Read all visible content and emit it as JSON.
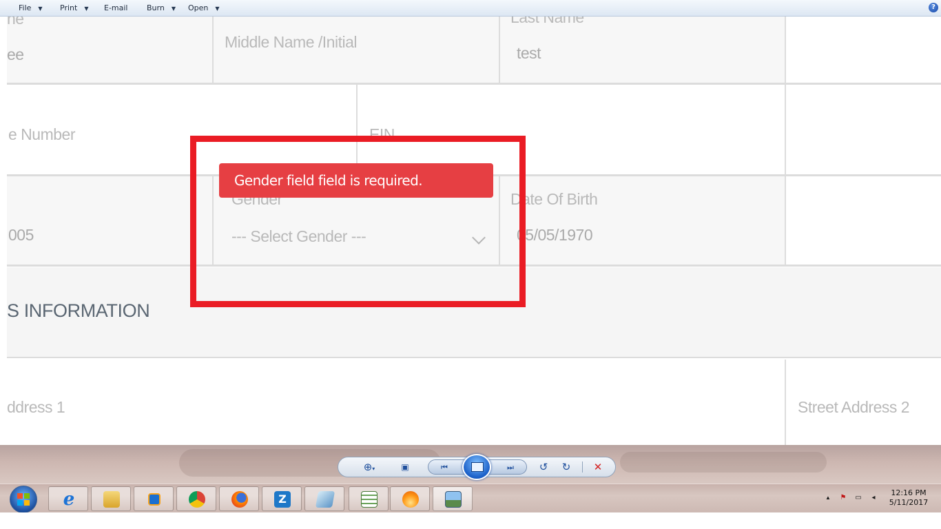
{
  "viewer": {
    "menu": {
      "file": "File",
      "print": "Print",
      "email": "E-mail",
      "burn": "Burn",
      "open": "Open",
      "help_icon": "?"
    },
    "controls": {
      "zoom": "zoom-icon",
      "fit": "actual-size-icon",
      "previous": "previous-icon",
      "slideshow": "slideshow-icon",
      "next": "next-icon",
      "rotate_ccw": "rotate-counterclockwise-icon",
      "rotate_cw": "rotate-clockwise-icon",
      "delete": "delete-icon"
    }
  },
  "form": {
    "row1": {
      "first_name_label": "ne",
      "first_name_value": "ee",
      "middle_name_label": "Middle Name /Initial",
      "last_name_label": "Last Name",
      "last_name_value": "test"
    },
    "row2": {
      "phone_label": "e Number",
      "ein_label": "EIN"
    },
    "row3": {
      "zip_value": "005",
      "gender_label": "Gender",
      "gender_placeholder": "--- Select Gender ---",
      "dob_label": "Date Of Birth",
      "dob_value": "05/05/1970"
    },
    "error_message": "Gender field field is required.",
    "section_title": "S INFORMATION",
    "row4": {
      "address1_label": "ddress 1",
      "address2_label": "Street Address 2"
    }
  },
  "taskbar": {
    "apps": [
      {
        "name": "internet-explorer-icon",
        "glyph": "e"
      },
      {
        "name": "file-explorer-icon",
        "glyph": ""
      },
      {
        "name": "media-player-icon",
        "glyph": ""
      },
      {
        "name": "chrome-icon",
        "glyph": ""
      },
      {
        "name": "firefox-icon",
        "glyph": ""
      },
      {
        "name": "zoho-icon",
        "glyph": "Z"
      },
      {
        "name": "notes-icon",
        "glyph": ""
      },
      {
        "name": "spreadsheet-icon",
        "glyph": ""
      },
      {
        "name": "flame-app-icon",
        "glyph": ""
      },
      {
        "name": "photo-viewer-icon",
        "glyph": ""
      }
    ],
    "clock_time": "12:16 PM",
    "clock_date": "5/11/2017"
  },
  "colors": {
    "error_red": "#e63f43",
    "annotation_red": "#ea1c24"
  }
}
